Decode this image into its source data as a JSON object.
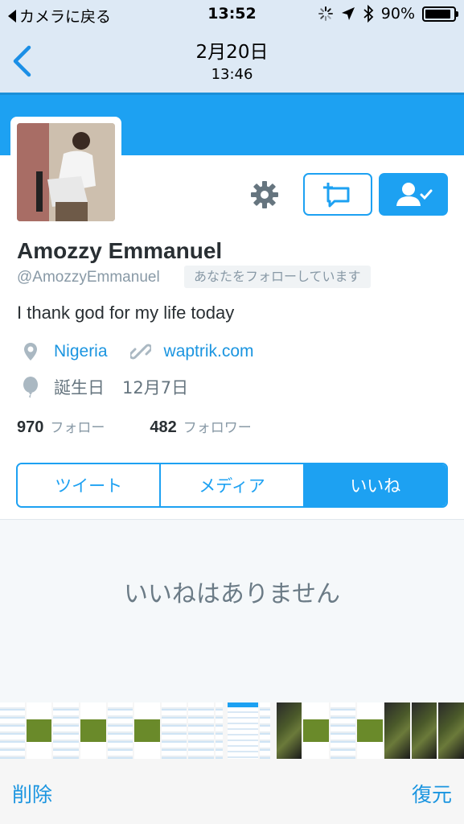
{
  "status_bar": {
    "back_app": "カメラに戻る",
    "time": "13:52",
    "battery": "90%",
    "battery_level": 0.9,
    "icons": [
      "activity-spinner-icon",
      "location-arrow-icon",
      "bluetooth-icon",
      "battery-icon"
    ]
  },
  "nav": {
    "title": "2月20日",
    "subtitle": "13:46",
    "back_icon": "chevron-left-icon"
  },
  "profile": {
    "name": "Amozzy Emmanuel",
    "handle": "@AmozzyEmmanuel",
    "follows_you": "あなたをフォローしています",
    "bio": "I thank god for my life today",
    "location": "Nigeria",
    "website": "waptrik.com",
    "birthday_label": "誕生日",
    "birthday": "12月7日",
    "following_count": "970",
    "following_label": "フォロー",
    "followers_count": "482",
    "followers_label": "フォロワー"
  },
  "tabs": [
    {
      "label": "ツイート",
      "active": false
    },
    {
      "label": "メディア",
      "active": false
    },
    {
      "label": "いいね",
      "active": true
    }
  ],
  "empty_state": "いいねはありません",
  "bottom_bar": {
    "delete": "削除",
    "restore": "復元"
  },
  "colors": {
    "accent": "#1da1f2",
    "link": "#1b95e0",
    "nav_background": "#dde9f5"
  }
}
